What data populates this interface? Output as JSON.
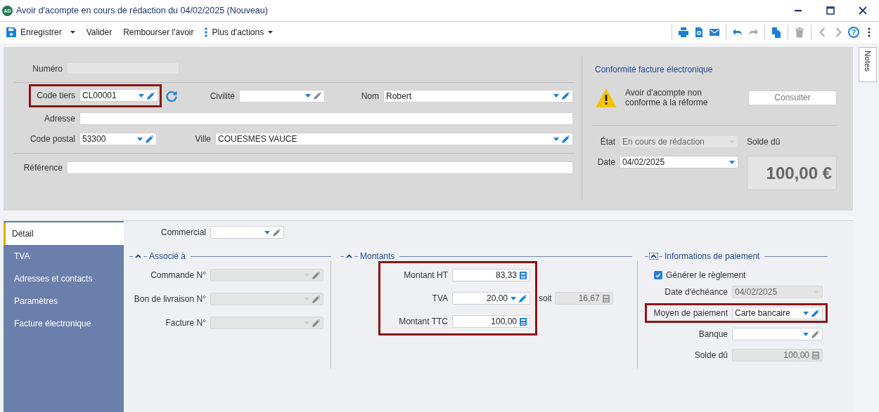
{
  "window": {
    "badge": "AD",
    "title": "Avoir d'acompte en cours de rédaction du 04/02/2025 (Nouveau)"
  },
  "toolbar": {
    "actions": [
      {
        "label": "Enregistrer",
        "kind": "save"
      },
      {
        "label": "Valider",
        "kind": "plain"
      },
      {
        "label": "Rembourser l'avoir",
        "kind": "plain"
      },
      {
        "label": "Plus d'actions",
        "kind": "more"
      }
    ],
    "tools": [
      {
        "kind": "separator"
      },
      {
        "kind": "print",
        "disabled": false
      },
      {
        "kind": "preview",
        "disabled": false
      },
      {
        "kind": "mail",
        "disabled": false
      },
      {
        "kind": "separator"
      },
      {
        "kind": "undo",
        "disabled": false
      },
      {
        "kind": "redo",
        "disabled": true
      },
      {
        "kind": "separator"
      },
      {
        "kind": "copy",
        "disabled": false
      },
      {
        "kind": "separator"
      },
      {
        "kind": "delete",
        "disabled": true
      },
      {
        "kind": "separator"
      },
      {
        "kind": "back",
        "disabled": true
      },
      {
        "kind": "forward",
        "disabled": true
      },
      {
        "kind": "help",
        "label": "?",
        "disabled": false
      },
      {
        "kind": "more",
        "disabled": false
      }
    ]
  },
  "notes_tab": {
    "label": "Notes"
  },
  "header": {
    "numero": {
      "label": "Numéro",
      "field": {
        "kind": "text",
        "disabled": true
      }
    },
    "code_tiers": {
      "label": "Code tiers",
      "highlighted": true,
      "field": {
        "kind": "combo",
        "value": "CL00001",
        "disabled": false
      }
    },
    "civilite": {
      "label": "Civilité",
      "field": {
        "kind": "combo",
        "disabled": false
      }
    },
    "nom": {
      "label": "Nom",
      "field": {
        "kind": "combo",
        "value": "Robert",
        "disabled": false
      }
    },
    "adresse": {
      "label": "Adresse",
      "field": {
        "kind": "text",
        "disabled": false
      }
    },
    "code_postal": {
      "label": "Code postal",
      "field": {
        "kind": "combo",
        "value": "53300",
        "disabled": false
      }
    },
    "ville": {
      "label": "Ville",
      "field": {
        "kind": "combo",
        "value": "COUESMES VAUCE",
        "disabled": false
      }
    },
    "reference": {
      "label": "Référence",
      "field": {
        "kind": "text",
        "disabled": false
      }
    }
  },
  "compliance": {
    "title": "Conformité facture électronique",
    "message": "Avoir d'acompte non conforme à la réforme",
    "button": "Consulter"
  },
  "status": {
    "etat": {
      "label": "État",
      "field": {
        "kind": "date",
        "value": "En cours de rédaction",
        "disabled": true
      }
    },
    "date": {
      "label": "Date",
      "field": {
        "kind": "date",
        "value": "04/02/2025",
        "disabled": false
      }
    },
    "solde": {
      "label": "Solde dû",
      "value": "100,00 €"
    }
  },
  "tabs": [
    {
      "label": "Détail",
      "selected": true
    },
    {
      "label": "TVA",
      "selected": false
    },
    {
      "label": "Adresses et contacts",
      "selected": false
    },
    {
      "label": "Paramètres",
      "selected": false
    },
    {
      "label": "Facture électronique",
      "selected": false
    }
  ],
  "detail": {
    "commercial": {
      "label": "Commercial",
      "field": {
        "kind": "combo",
        "disabled": false
      }
    },
    "sections": [
      {
        "title": "Associé à",
        "focused": false,
        "highlighted": false,
        "rows": [
          {
            "kind": "field",
            "label": "Commande N°",
            "highlighted": false,
            "field": {
              "kind": "combo",
              "disabled": true
            }
          },
          {
            "kind": "field",
            "label": "Bon de livraison N°",
            "highlighted": false,
            "field": {
              "kind": "combo",
              "disabled": true
            }
          },
          {
            "kind": "field",
            "label": "Facture N°",
            "highlighted": false,
            "field": {
              "kind": "combo",
              "disabled": true
            }
          }
        ]
      },
      {
        "title": "Montants",
        "focused": false,
        "highlighted": true,
        "rows": [
          {
            "kind": "field",
            "label": "Montant HT",
            "highlighted": false,
            "field": {
              "kind": "amount",
              "value": "83,33",
              "disabled": false
            }
          },
          {
            "kind": "field",
            "label": "TVA",
            "highlighted": false,
            "field": {
              "kind": "amount_combo",
              "value": "20,00",
              "disabled": false
            },
            "extra": {
              "label": "soit",
              "field": {
                "kind": "amount",
                "value": "16,67",
                "disabled": true
              }
            }
          },
          {
            "kind": "field",
            "label": "Montant TTC",
            "highlighted": false,
            "field": {
              "kind": "amount",
              "value": "100,00",
              "disabled": false
            }
          }
        ]
      },
      {
        "title": "Informations de paiement",
        "focused": true,
        "highlighted": false,
        "rows": [
          {
            "kind": "checkbox",
            "label": "Générer le règlement",
            "checked": true
          },
          {
            "kind": "field",
            "label": "Date d'échéance",
            "highlighted": false,
            "field": {
              "kind": "date",
              "value": "04/02/2025",
              "disabled": true
            }
          },
          {
            "kind": "field",
            "label": "Moyen de paiement",
            "highlighted": true,
            "field": {
              "kind": "combo",
              "value": "Carte bancaire",
              "disabled": false
            }
          },
          {
            "kind": "field",
            "label": "Banque",
            "highlighted": false,
            "field": {
              "kind": "combo",
              "disabled": false
            }
          },
          {
            "kind": "field",
            "label": "Solde dû",
            "highlighted": false,
            "field": {
              "kind": "amount",
              "value": "100,00",
              "disabled": true
            }
          }
        ]
      }
    ]
  }
}
